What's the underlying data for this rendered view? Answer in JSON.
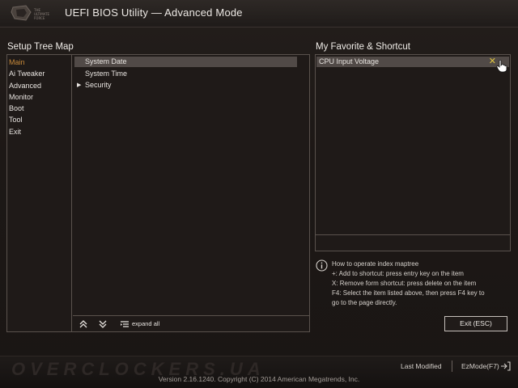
{
  "app": {
    "title": "UEFI BIOS Utility — Advanced Mode"
  },
  "tree_map": {
    "heading": "Setup Tree Map",
    "menu": [
      "Main",
      "Ai Tweaker",
      "Advanced",
      "Monitor",
      "Boot",
      "Tool",
      "Exit"
    ],
    "active_menu": "Main",
    "items": [
      {
        "label": "System Date",
        "selected": true,
        "expandable": false
      },
      {
        "label": "System Time",
        "selected": false,
        "expandable": false
      },
      {
        "label": "Security",
        "selected": false,
        "expandable": true
      }
    ],
    "expand_all_label": "expand all"
  },
  "favorite": {
    "heading": "My Favorite & Shortcut",
    "items": [
      "CPU Input Voltage"
    ]
  },
  "help": {
    "lines": [
      "How to operate index maptree",
      "+: Add to shortcut: press entry key on the item",
      "X: Remove form shortcut: press delete on the item",
      "F4: Select the item listed above, then press F4 key to",
      "go to the page directly."
    ]
  },
  "exit_button": "Exit (ESC)",
  "bottom": {
    "last_modified": "Last Modified",
    "ezmode": "EzMode(F7)",
    "copyright": "Version 2.16.1240. Copyright (C) 2014 American Megatrends, Inc.",
    "watermark": "OVERCLOCKERS.UA"
  }
}
